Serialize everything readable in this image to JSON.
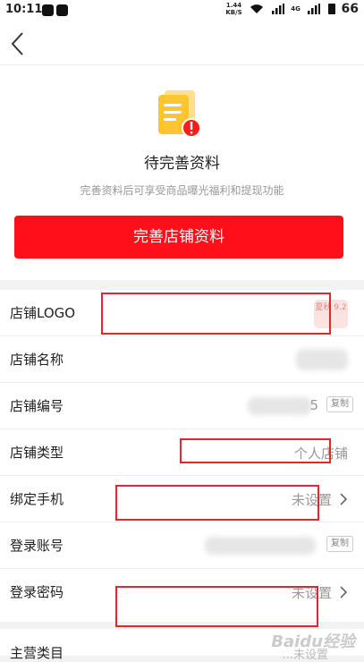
{
  "status_bar": {
    "time": "10:11",
    "net_speed_value": "1.44",
    "net_speed_unit": "KB/S",
    "signal_label": "4G",
    "battery": "66"
  },
  "hero": {
    "title": "待完善资料",
    "subtitle": "完善资料后可享受商品曝光福利和提现功能",
    "button_label": "完善店铺资料"
  },
  "rows": [
    {
      "label": "店铺LOGO",
      "thumb_text": "夏秋 9.2"
    },
    {
      "label": "店铺名称"
    },
    {
      "label": "店铺编号",
      "value_fragment": "5",
      "copy_label": "复制"
    },
    {
      "label": "店铺类型",
      "value": "个人店铺"
    },
    {
      "label": "绑定手机",
      "value": "未设置"
    },
    {
      "label": "登录账号",
      "copy_label": "复制"
    },
    {
      "label": "登录密码",
      "value": "未设置"
    }
  ],
  "partial_row": {
    "label": "主营类目",
    "value": "...未设置"
  },
  "watermark": "Baidu经验"
}
